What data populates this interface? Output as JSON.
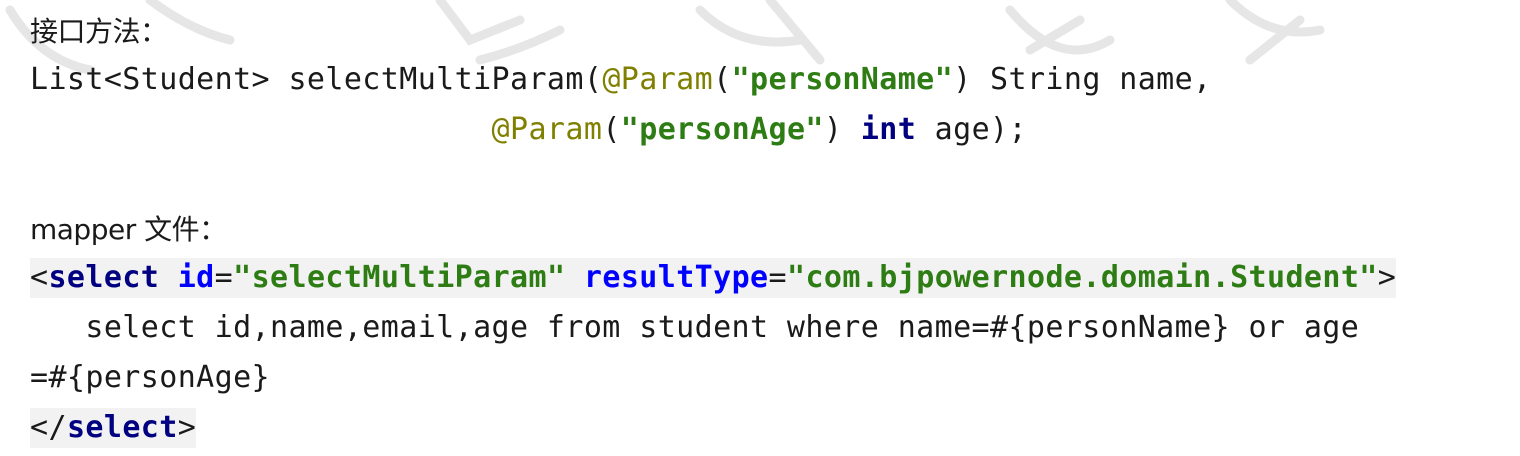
{
  "section_interface": {
    "label": "接口方法："
  },
  "interface_code": {
    "line1": {
      "prefix": "List<Student> selectMultiParam(",
      "ann1": "@Param",
      "open1": "(",
      "str1": "\"personName\"",
      "mid1": ") String name,"
    },
    "line2": {
      "indent": "                         ",
      "ann2": "@Param",
      "open2": "(",
      "str2": "\"personAge\"",
      "mid2": ") ",
      "kw_int": "int",
      "tail2": " age);"
    }
  },
  "section_mapper": {
    "label": "mapper 文件："
  },
  "mapper_code": {
    "open_tag": {
      "lt": "<",
      "tag": "select",
      "sp1": " ",
      "attr_id": "id",
      "eq1": "=",
      "val_id": "\"selectMultiParam\"",
      "sp2": " ",
      "attr_rt": "resultType",
      "eq2": "=",
      "val_rt": "\"com.bjpowernode.domain.Student\"",
      "gt": ">"
    },
    "sql_line1": "   select id,name,email,age from student where name=#{personName} or age",
    "sql_line2": "=#{personAge}",
    "close_tag": {
      "lt": "</",
      "tag": "select",
      "gt": ">"
    }
  }
}
